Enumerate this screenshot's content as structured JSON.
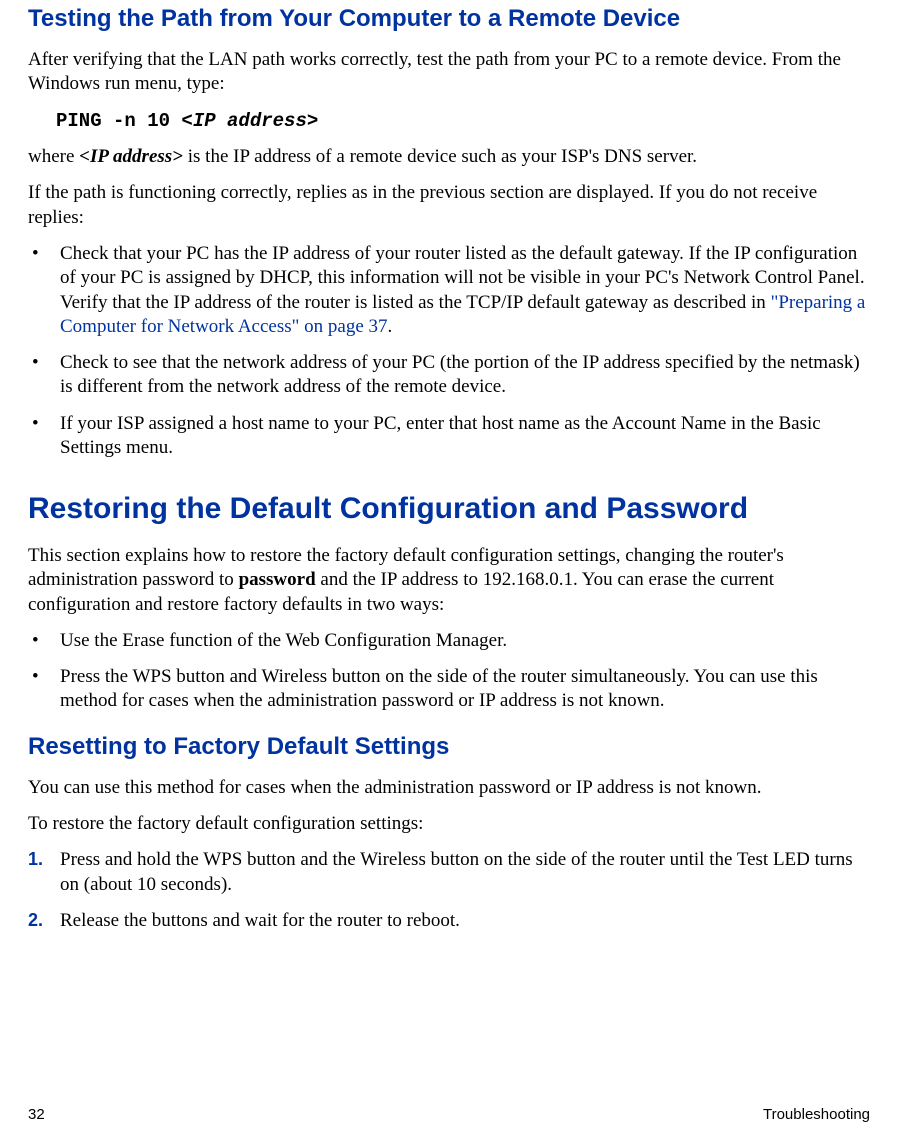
{
  "section1": {
    "heading": "Testing the Path from Your Computer to a Remote Device",
    "para1": "After verifying that the LAN path works correctly, test the path from your PC to a remote device. From the Windows run menu, type:",
    "cmd_part1": "PING -n 10 <",
    "cmd_ip": "IP address",
    "cmd_part2": ">",
    "para2_pre": "where ",
    "para2_ip": "<IP address>",
    "para2_post": " is the IP address of a remote device such as your ISP's DNS server.",
    "para3": "If the path is functioning correctly, replies as in the previous section are displayed. If you do not receive replies:",
    "bullets": [
      {
        "pre": "Check that your PC has the IP address of your router listed as the default gateway. If the IP configuration of your PC is assigned by DHCP, this information will not be visible in your PC's Network Control Panel. Verify that the IP address of the router is listed as the TCP/IP default gateway as described in ",
        "link": "\"Preparing a Computer for Network Access\" on page 37",
        "post": "."
      },
      {
        "pre": "Check to see that the network address of your PC (the portion of the IP address specified by the netmask) is different from the network address of the remote device.",
        "link": "",
        "post": ""
      },
      {
        "pre": "If your ISP assigned a host name to your PC, enter that host name as the Account Name in the Basic Settings menu.",
        "link": "",
        "post": ""
      }
    ]
  },
  "section2": {
    "heading": "Restoring the Default Configuration and Password",
    "para1_pre": "This section explains how to restore the factory default configuration settings, changing the router's administration password to ",
    "para1_bold": "password",
    "para1_post": " and the IP address to 192.168.0.1. You can erase the current configuration and restore factory defaults in two ways:",
    "bullets": [
      "Use the Erase function of the Web Configuration Manager.",
      "Press the WPS button and Wireless button on the side of the router simultaneously. You can use this method for cases when the administration password or IP address is not known."
    ]
  },
  "section3": {
    "heading": "Resetting to Factory Default Settings",
    "para1": "You can use this method for cases when the administration password or IP address is not known.",
    "para2": "To restore the factory default configuration settings:",
    "steps": [
      {
        "n": "1.",
        "text": "Press and hold the WPS button and the Wireless button on the side of the router until the Test LED turns on (about 10 seconds)."
      },
      {
        "n": "2.",
        "text": "Release the buttons and wait for the router to reboot."
      }
    ]
  },
  "footer": {
    "page": "32",
    "title": "Troubleshooting"
  }
}
